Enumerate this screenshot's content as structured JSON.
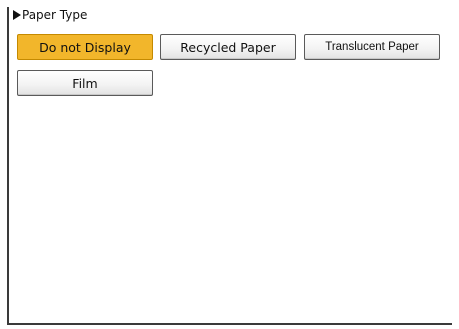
{
  "section": {
    "title": "Paper Type",
    "arrow_icon": "right-triangle-icon"
  },
  "options": [
    {
      "label": "Do not Display",
      "selected": true
    },
    {
      "label": "Recycled Paper",
      "selected": false
    },
    {
      "label": "Translucent Paper",
      "selected": false
    },
    {
      "label": "Film",
      "selected": false
    }
  ],
  "colors": {
    "selected": "#f2b62b",
    "border": "#5a5a5a",
    "frame": "#3a3a3a"
  }
}
